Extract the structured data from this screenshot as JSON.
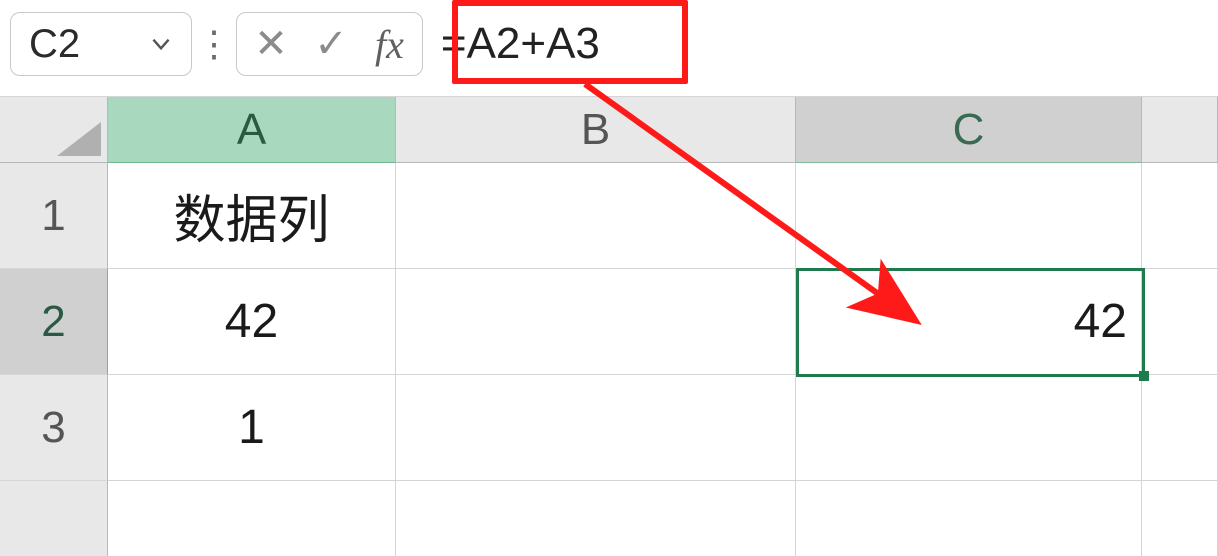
{
  "formula_bar": {
    "name_box": "C2",
    "cancel_glyph": "✕",
    "enter_glyph": "✓",
    "fx_label": "fx",
    "formula": "=A2+A3"
  },
  "column_headers": [
    "A",
    "B",
    "C"
  ],
  "row_headers": [
    "1",
    "2",
    "3"
  ],
  "cells": {
    "A1": "数据列",
    "A2": "42",
    "A3": "1",
    "C2": "42"
  },
  "selection": {
    "cell": "C2"
  },
  "annotation": {
    "highlight_target": "formula",
    "arrow_from": "formula",
    "arrow_to": "C2"
  }
}
